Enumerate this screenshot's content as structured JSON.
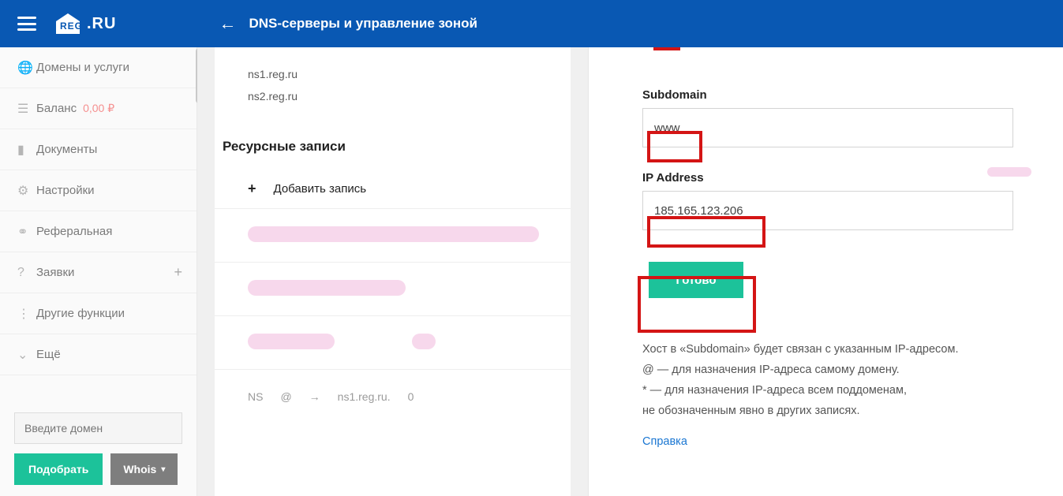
{
  "header": {
    "page_title": "DNS-серверы и управление зоной",
    "logo_text": "REG",
    "logo_suffix": ".RU"
  },
  "sidebar": {
    "items": [
      {
        "icon": "🌐",
        "label": "Домены и услуги"
      },
      {
        "icon": "☰",
        "label": "Баланс",
        "balance": "0,00 ₽"
      },
      {
        "icon": "▮",
        "label": "Документы"
      },
      {
        "icon": "⚙",
        "label": "Настройки"
      },
      {
        "icon": "⚭",
        "label": "Реферальная"
      },
      {
        "icon": "?",
        "label": "Заявки",
        "plus": "+"
      },
      {
        "icon": "⋮",
        "label": "Другие функции"
      },
      {
        "icon": "⌄",
        "label": "Ещё"
      }
    ],
    "domain_placeholder": "Введите домен",
    "btn_pick": "Подобрать",
    "btn_whois": "Whois"
  },
  "main": {
    "ns_servers": [
      "ns1.reg.ru",
      "ns2.reg.ru"
    ],
    "section": "Ресурсные записи",
    "add_label": "Добавить запись",
    "record": {
      "type": "NS",
      "host": "@",
      "arrow": "→",
      "target": "ns1.reg.ru.",
      "ttl": "0"
    }
  },
  "panel": {
    "type": "A",
    "subdomain_label": "Subdomain",
    "subdomain_value": "www",
    "ip_label": "IP Address",
    "ip_value": "185.165.123.206",
    "done": "Готово",
    "help1": "Хост в «Subdomain» будет связан с указанным IP-адресом.",
    "help2": "@ — для назначения IP-адреса самому домену.",
    "help3": "* — для назначения IP-адреса всем поддоменам,",
    "help4": "не обозначенным явно в других записях.",
    "help_link": "Справка"
  }
}
